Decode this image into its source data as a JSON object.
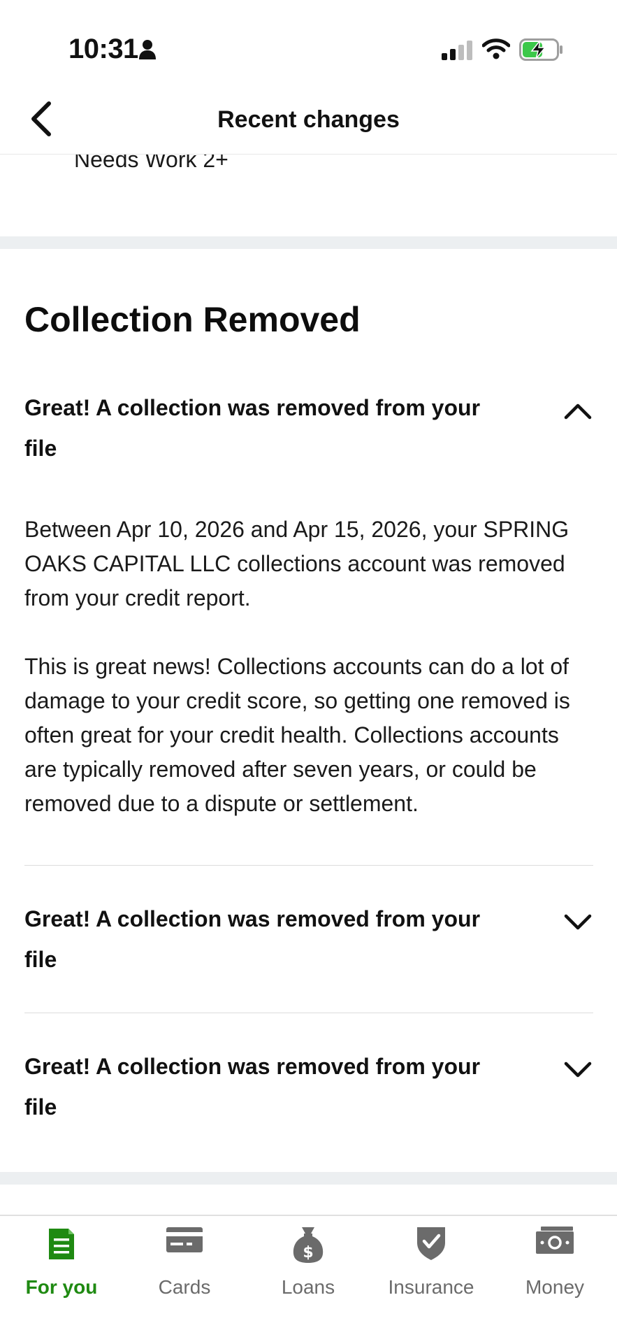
{
  "status_bar": {
    "time": "10:31"
  },
  "header": {
    "title": "Recent changes"
  },
  "previous_item_tail": "Needs Work 2+",
  "section": {
    "title": "Collection Removed",
    "items": [
      {
        "title": "Great! A collection was removed from your file",
        "expanded": true,
        "body": [
          "Between Apr 10, 2026 and Apr 15, 2026, your SPRING OAKS CAPITAL LLC collections account was removed from your credit report.",
          "This is great news! Collections accounts can do a lot of damage to your credit score, so getting one removed is often great for your credit health. Collections accounts are typically removed after seven years, or could be removed due to a dispute or settlement."
        ]
      },
      {
        "title": "Great! A collection was removed from your file",
        "expanded": false
      },
      {
        "title": "Great! A collection was removed from your file",
        "expanded": false
      }
    ]
  },
  "tabs": [
    {
      "label": "For you",
      "icon": "document-icon",
      "active": true
    },
    {
      "label": "Cards",
      "icon": "credit-card-icon",
      "active": false
    },
    {
      "label": "Loans",
      "icon": "money-bag-icon",
      "active": false
    },
    {
      "label": "Insurance",
      "icon": "shield-check-icon",
      "active": false
    },
    {
      "label": "Money",
      "icon": "banknote-icon",
      "active": false
    }
  ],
  "colors": {
    "accent": "#1f8a12",
    "inactive_tab": "#6b6b6b",
    "divider_band": "#eceff1",
    "text": "#111111",
    "battery_fill": "#3cc84a"
  }
}
